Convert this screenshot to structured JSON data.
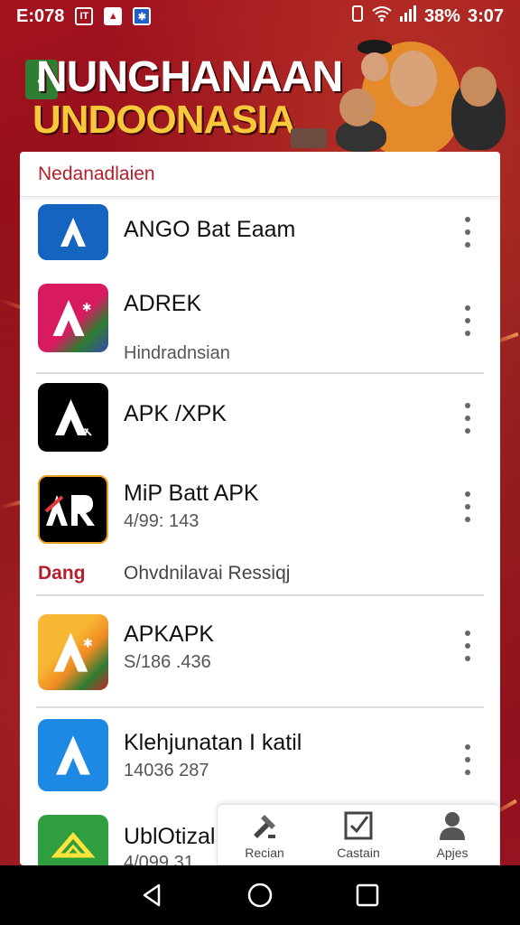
{
  "status_bar": {
    "time_left": "E:078",
    "battery": "38%",
    "time_right": "3:07",
    "icons": [
      "notification-icon",
      "photo-icon",
      "app-icon",
      "vibrate-icon",
      "wifi-icon",
      "signal-icon"
    ]
  },
  "banner": {
    "title_line1": "NUNGHANAAN",
    "title_line2": "UNDOONASIA"
  },
  "list": {
    "header": "Nedanadlaien",
    "items": [
      {
        "name": "ANGO Bat Eaam",
        "sub": "",
        "icon": "A",
        "icon_bg": "#1565c0"
      },
      {
        "name": "ADREK",
        "sub": "Hindradnsian",
        "icon": "A",
        "icon_bg": "#d81b60"
      },
      {
        "name": "APK /XPK",
        "sub": "",
        "icon": "A",
        "icon_bg": "#000000"
      },
      {
        "name": "MiP Batt APK",
        "sub": "4/99: 143",
        "icon": "AR",
        "icon_bg": "#000000"
      },
      {
        "name": "APKAPK",
        "sub": "S/186 .436",
        "icon": "A",
        "icon_bg": "#f5a623"
      },
      {
        "name": "Klehjunatan I katil",
        "sub": "14036 287",
        "icon": "A",
        "icon_bg": "#1e88e5"
      },
      {
        "name": "UblOtizal",
        "sub": "4/099 31",
        "icon": "A",
        "icon_bg": "#2e9e3e"
      }
    ],
    "section": {
      "label": "Dang",
      "text": "Ohvdnilavai Ressiqj"
    }
  },
  "tabs": [
    {
      "label": "Recian",
      "icon": "tools-icon"
    },
    {
      "label": "Castain",
      "icon": "checkbox-icon"
    },
    {
      "label": "Apjes",
      "icon": "person-icon"
    }
  ],
  "navbar": {
    "icons": [
      "back-icon",
      "home-icon",
      "recents-icon"
    ]
  },
  "colors": {
    "accent": "#b3202c",
    "banner_bg": "#8c0f1a",
    "title_yellow": "#f7c83a"
  }
}
